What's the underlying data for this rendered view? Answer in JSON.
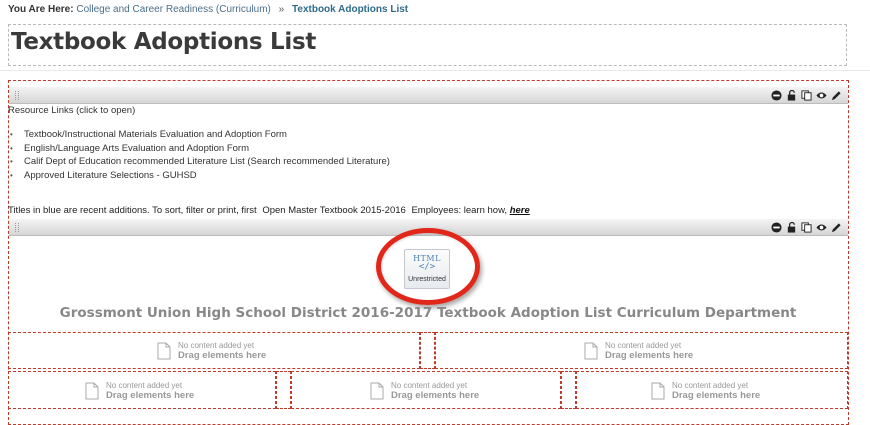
{
  "breadcrumb": {
    "prefix": "You Are Here:",
    "parent": "College and Career Readiness (Curriculum)",
    "separator": "»",
    "current": "Textbook Adoptions List"
  },
  "page_title": "Textbook Adoptions List",
  "toolbar_icons": [
    "remove-icon",
    "unlock-icon",
    "copy-icon",
    "view-icon",
    "edit-icon"
  ],
  "resources": {
    "heading": "Resource Links (click to open)",
    "items": [
      "Textbook/Instructional Materials Evaluation and Adoption Form",
      "English/Language Arts Evaluation and Adoption Form",
      "Calif Dept of Education recommended Literature List (Search recommended Literature)",
      "Approved Literature Selections - GUHSD"
    ]
  },
  "note": {
    "text": "Titles in blue are recent additions. To sort, filter or print, first",
    "master": "Open Master Textbook 2015-2016",
    "employees": "Employees: learn how,",
    "link": "here"
  },
  "html_widget": {
    "title": "HTML",
    "code": "</>",
    "label": "Unrestricted"
  },
  "district_heading": "Grossmont Union High School District 2016-2017 Textbook Adoption List Curriculum Department",
  "placeholder": {
    "small": "No content added yet",
    "big": "Drag elements here"
  },
  "colors": {
    "dashed_border": "#c0392b",
    "highlight_ring": "#e0271a",
    "breadcrumb_current": "#2f6c8a"
  }
}
